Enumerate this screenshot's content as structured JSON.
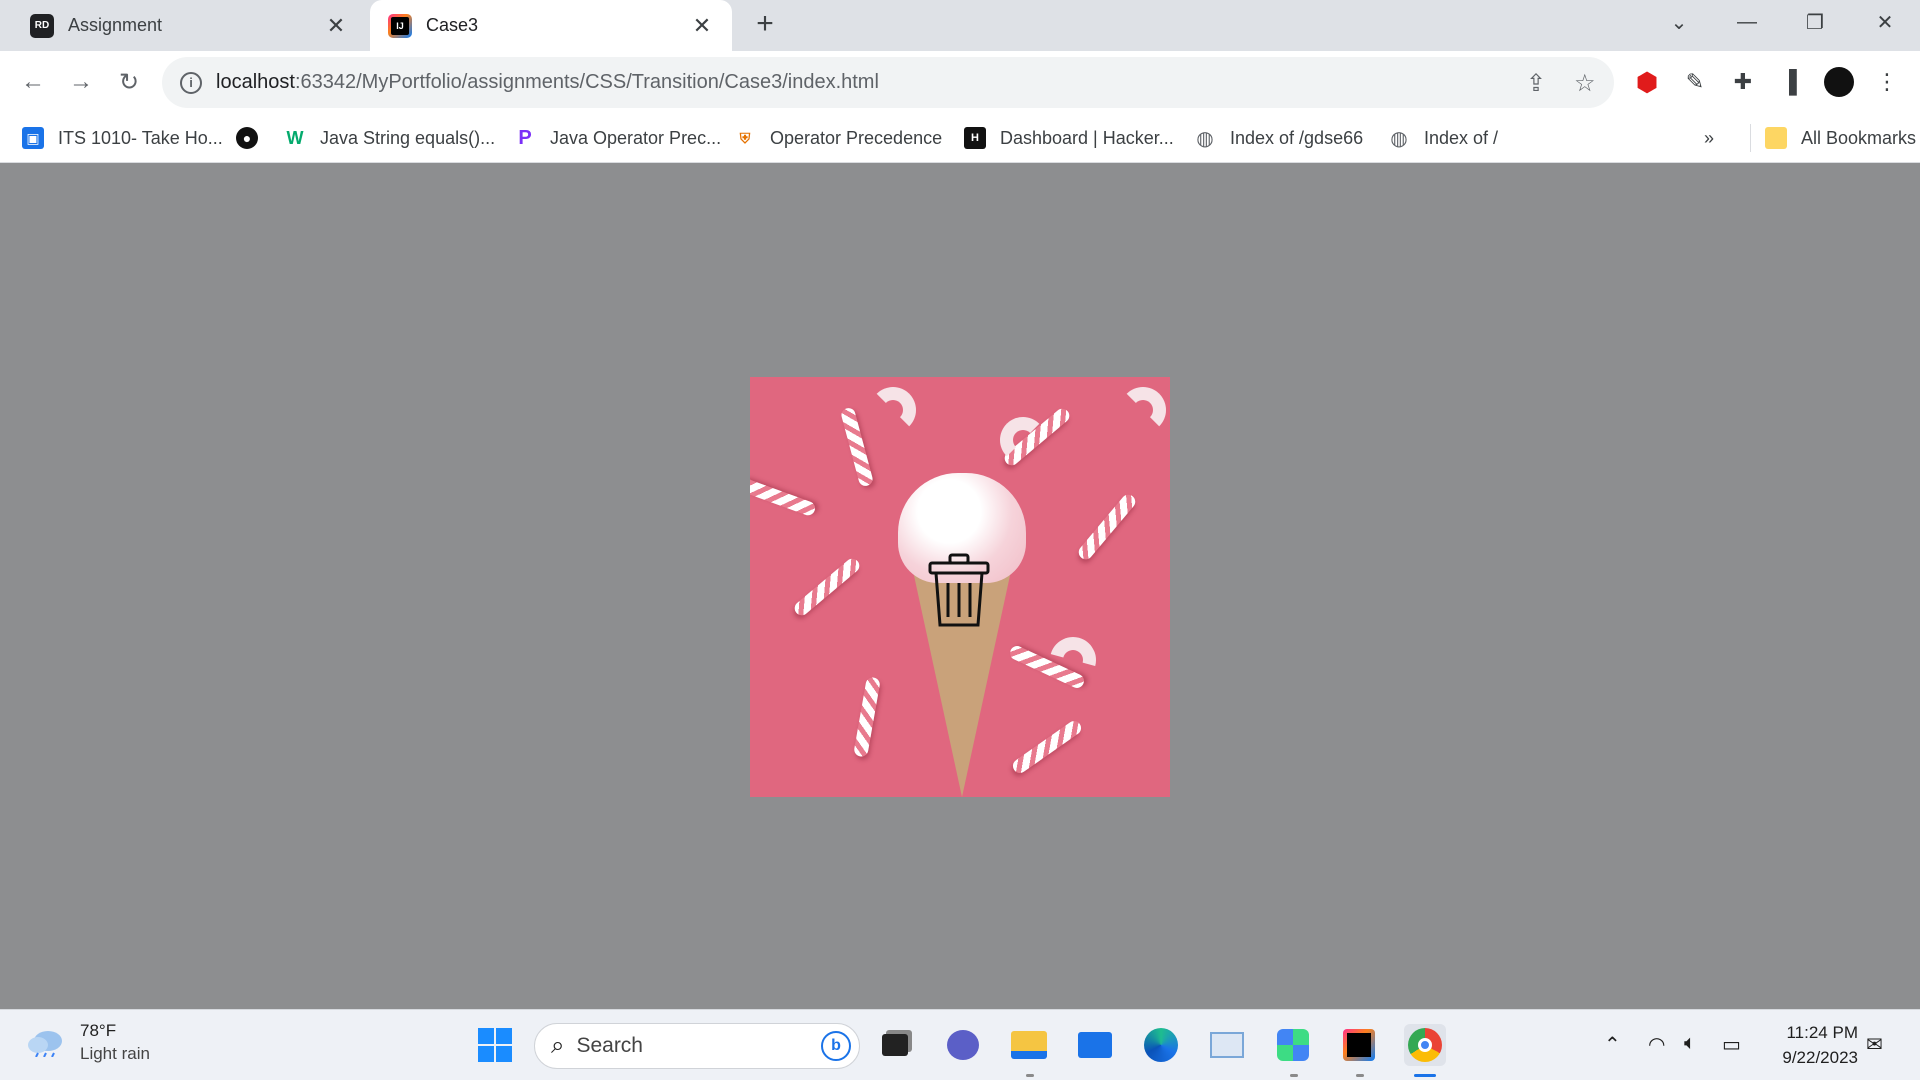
{
  "browser": {
    "tabs": [
      {
        "label": "Assignment",
        "favicon": "RD"
      },
      {
        "label": "Case3",
        "favicon": "IJ"
      }
    ],
    "address": {
      "host": "localhost",
      "path": ":63342/MyPortfolio/assignments/CSS/Transition/Case3/index.html"
    },
    "bookmarks": [
      {
        "label": "ITS 1010- Take Ho..."
      },
      {
        "label": ""
      },
      {
        "label": "Java String equals()..."
      },
      {
        "label": "Java Operator Prec..."
      },
      {
        "label": "Operator Precedence"
      },
      {
        "label": "Dashboard | Hacker..."
      },
      {
        "label": "Index of /gdse66"
      },
      {
        "label": "Index of /"
      }
    ],
    "overflow": "»",
    "all_bookmarks": "All Bookmarks"
  },
  "page": {
    "image_subject": "ice cream cone with candy canes",
    "overlay_icon": "trash-icon"
  },
  "taskbar": {
    "weather_temp": "78°F",
    "weather_cond": "Light rain",
    "search_label": "Search",
    "time": "11:24 PM",
    "date": "9/22/2023"
  }
}
